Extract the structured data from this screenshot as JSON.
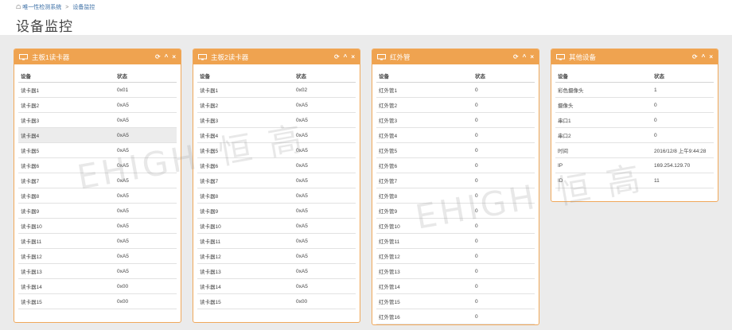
{
  "breadcrumb": {
    "home": "唯一性检测系统",
    "separator": ">",
    "current": "设备监控"
  },
  "page_title": "设备监控",
  "panel_tools": {
    "refresh": "⟳",
    "collapse": "^",
    "close": "×"
  },
  "columns": {
    "device": "设备",
    "status": "状态"
  },
  "panels": [
    {
      "title": "主板1读卡器",
      "rows": [
        [
          "读卡器1",
          "0x01"
        ],
        [
          "读卡器2",
          "0xA5"
        ],
        [
          "读卡器3",
          "0xA5"
        ],
        [
          "读卡器4",
          "0xA5"
        ],
        [
          "读卡器5",
          "0xA5"
        ],
        [
          "读卡器6",
          "0xA5"
        ],
        [
          "读卡器7",
          "0xA5"
        ],
        [
          "读卡器8",
          "0xA5"
        ],
        [
          "读卡器9",
          "0xA5"
        ],
        [
          "读卡器10",
          "0xA5"
        ],
        [
          "读卡器11",
          "0xA5"
        ],
        [
          "读卡器12",
          "0xA5"
        ],
        [
          "读卡器13",
          "0xA5"
        ],
        [
          "读卡器14",
          "0x00"
        ],
        [
          "读卡器15",
          "0x00"
        ]
      ]
    },
    {
      "title": "主板2读卡器",
      "rows": [
        [
          "读卡器1",
          "0x02"
        ],
        [
          "读卡器2",
          "0xA5"
        ],
        [
          "读卡器3",
          "0xA5"
        ],
        [
          "读卡器4",
          "0xA5"
        ],
        [
          "读卡器5",
          "0xA5"
        ],
        [
          "读卡器6",
          "0xA5"
        ],
        [
          "读卡器7",
          "0xA5"
        ],
        [
          "读卡器8",
          "0xA5"
        ],
        [
          "读卡器9",
          "0xA5"
        ],
        [
          "读卡器10",
          "0xA5"
        ],
        [
          "读卡器11",
          "0xA5"
        ],
        [
          "读卡器12",
          "0xA5"
        ],
        [
          "读卡器13",
          "0xA5"
        ],
        [
          "读卡器14",
          "0xA5"
        ],
        [
          "读卡器15",
          "0x00"
        ]
      ]
    },
    {
      "title": "红外管",
      "rows": [
        [
          "红外管1",
          "0"
        ],
        [
          "红外管2",
          "0"
        ],
        [
          "红外管3",
          "0"
        ],
        [
          "红外管4",
          "0"
        ],
        [
          "红外管5",
          "0"
        ],
        [
          "红外管6",
          "0"
        ],
        [
          "红外管7",
          "0"
        ],
        [
          "红外管8",
          "0"
        ],
        [
          "红外管9",
          "0"
        ],
        [
          "红外管10",
          "0"
        ],
        [
          "红外管11",
          "0"
        ],
        [
          "红外管12",
          "0"
        ],
        [
          "红外管13",
          "0"
        ],
        [
          "红外管14",
          "0"
        ],
        [
          "红外管15",
          "0"
        ],
        [
          "红外管16",
          "0"
        ]
      ]
    },
    {
      "title": "其他设备",
      "rows": [
        [
          "彩色摄像头",
          "1"
        ],
        [
          "摄像头",
          "0"
        ],
        [
          "串口1",
          "0"
        ],
        [
          "串口2",
          "0"
        ],
        [
          "时间",
          "2016/12/8 上午9:44:28"
        ],
        [
          "IP",
          "169.254.129.70"
        ],
        [
          "ID",
          "11"
        ]
      ]
    }
  ],
  "watermark": {
    "latin": "EHIGH",
    "chinese": "恒 高"
  },
  "colors": {
    "panel_header": "#efa350",
    "link": "#3a6ea5"
  }
}
